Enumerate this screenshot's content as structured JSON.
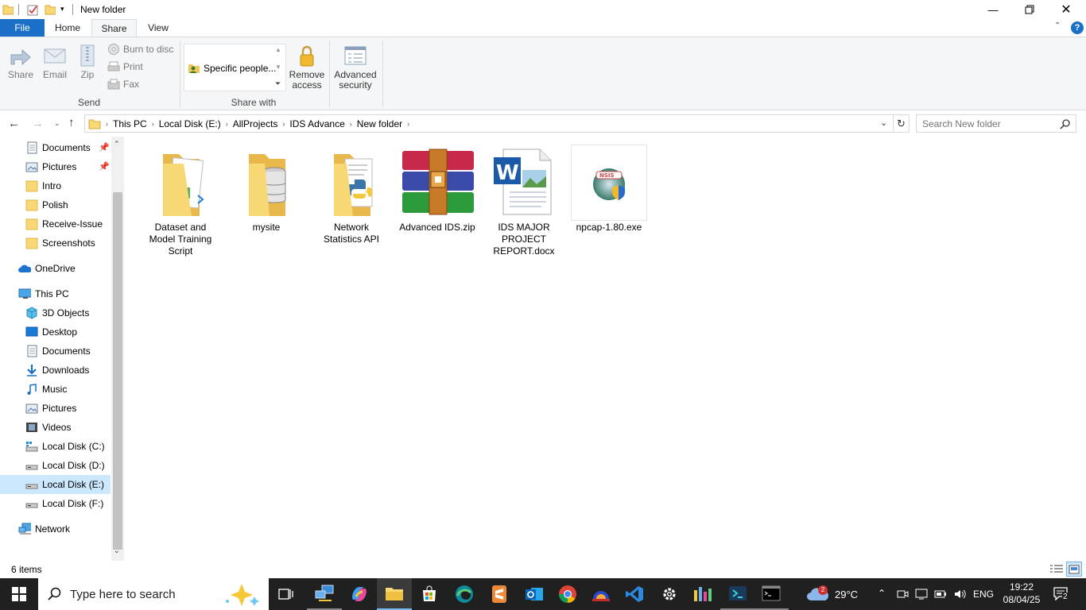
{
  "window": {
    "title": "New folder"
  },
  "ribbon_tabs": {
    "file": "File",
    "home": "Home",
    "share": "Share",
    "view": "View"
  },
  "ribbon": {
    "share": "Share",
    "email": "Email",
    "zip": "Zip",
    "burn": "Burn to disc",
    "print": "Print",
    "fax": "Fax",
    "send_group": "Send",
    "specific_people": "Specific people...",
    "share_with_group": "Share with",
    "remove_access_1": "Remove",
    "remove_access_2": "access",
    "advanced_security_1": "Advanced",
    "advanced_security_2": "security"
  },
  "breadcrumb": [
    "This PC",
    "Local Disk (E:)",
    "AllProjects",
    "IDS Advance",
    "New folder"
  ],
  "search": {
    "placeholder": "Search New folder"
  },
  "nav_pane": {
    "documents_pinned": "Documents",
    "pictures_pinned": "Pictures",
    "intro": "Intro",
    "polish": "Polish",
    "receive_issue": "Receive-Issue",
    "screenshots": "Screenshots",
    "onedrive": "OneDrive",
    "this_pc": "This PC",
    "objects3d": "3D Objects",
    "desktop": "Desktop",
    "documents": "Documents",
    "downloads": "Downloads",
    "music": "Music",
    "pictures": "Pictures",
    "videos": "Videos",
    "disk_c": "Local Disk (C:)",
    "disk_d": "Local Disk (D:)",
    "disk_e": "Local Disk (E:)",
    "disk_f": "Local Disk (F:)",
    "network": "Network"
  },
  "files": {
    "f1": {
      "l1": "Dataset and",
      "l2": "Model Training",
      "l3": "Script"
    },
    "f2": {
      "l1": "mysite"
    },
    "f3": {
      "l1": "Network",
      "l2": "Statistics API"
    },
    "f4": {
      "l1": "Advanced IDS.zip"
    },
    "f5": {
      "l1": "IDS MAJOR",
      "l2": "PROJECT",
      "l3": "REPORT.docx"
    },
    "f6": {
      "l1": "npcap-1.80.exe"
    }
  },
  "status": {
    "items": "6 items"
  },
  "taskbar": {
    "search_placeholder": "Type here to search",
    "weather_temp": "29°C",
    "weather_badge": "2",
    "language": "ENG",
    "time": "19:22",
    "date": "08/04/25",
    "notifications": "2"
  },
  "colors": {
    "accent": "#1a6fc6",
    "selected": "#cce8ff",
    "folder": "#f8d775",
    "taskbar": "#202020"
  }
}
